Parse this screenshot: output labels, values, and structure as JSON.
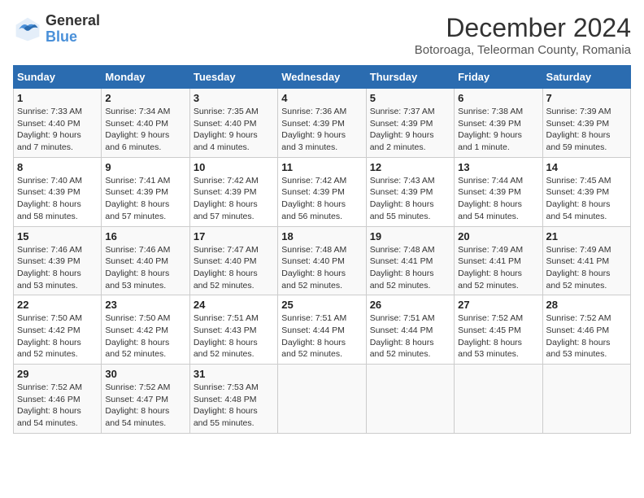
{
  "header": {
    "logo_line1": "General",
    "logo_line2": "Blue",
    "month_title": "December 2024",
    "location": "Botoroaga, Teleorman County, Romania"
  },
  "columns": [
    "Sunday",
    "Monday",
    "Tuesday",
    "Wednesday",
    "Thursday",
    "Friday",
    "Saturday"
  ],
  "weeks": [
    [
      {
        "day": "1",
        "info": "Sunrise: 7:33 AM\nSunset: 4:40 PM\nDaylight: 9 hours\nand 7 minutes."
      },
      {
        "day": "2",
        "info": "Sunrise: 7:34 AM\nSunset: 4:40 PM\nDaylight: 9 hours\nand 6 minutes."
      },
      {
        "day": "3",
        "info": "Sunrise: 7:35 AM\nSunset: 4:40 PM\nDaylight: 9 hours\nand 4 minutes."
      },
      {
        "day": "4",
        "info": "Sunrise: 7:36 AM\nSunset: 4:39 PM\nDaylight: 9 hours\nand 3 minutes."
      },
      {
        "day": "5",
        "info": "Sunrise: 7:37 AM\nSunset: 4:39 PM\nDaylight: 9 hours\nand 2 minutes."
      },
      {
        "day": "6",
        "info": "Sunrise: 7:38 AM\nSunset: 4:39 PM\nDaylight: 9 hours\nand 1 minute."
      },
      {
        "day": "7",
        "info": "Sunrise: 7:39 AM\nSunset: 4:39 PM\nDaylight: 8 hours\nand 59 minutes."
      }
    ],
    [
      {
        "day": "8",
        "info": "Sunrise: 7:40 AM\nSunset: 4:39 PM\nDaylight: 8 hours\nand 58 minutes."
      },
      {
        "day": "9",
        "info": "Sunrise: 7:41 AM\nSunset: 4:39 PM\nDaylight: 8 hours\nand 57 minutes."
      },
      {
        "day": "10",
        "info": "Sunrise: 7:42 AM\nSunset: 4:39 PM\nDaylight: 8 hours\nand 57 minutes."
      },
      {
        "day": "11",
        "info": "Sunrise: 7:42 AM\nSunset: 4:39 PM\nDaylight: 8 hours\nand 56 minutes."
      },
      {
        "day": "12",
        "info": "Sunrise: 7:43 AM\nSunset: 4:39 PM\nDaylight: 8 hours\nand 55 minutes."
      },
      {
        "day": "13",
        "info": "Sunrise: 7:44 AM\nSunset: 4:39 PM\nDaylight: 8 hours\nand 54 minutes."
      },
      {
        "day": "14",
        "info": "Sunrise: 7:45 AM\nSunset: 4:39 PM\nDaylight: 8 hours\nand 54 minutes."
      }
    ],
    [
      {
        "day": "15",
        "info": "Sunrise: 7:46 AM\nSunset: 4:39 PM\nDaylight: 8 hours\nand 53 minutes."
      },
      {
        "day": "16",
        "info": "Sunrise: 7:46 AM\nSunset: 4:40 PM\nDaylight: 8 hours\nand 53 minutes."
      },
      {
        "day": "17",
        "info": "Sunrise: 7:47 AM\nSunset: 4:40 PM\nDaylight: 8 hours\nand 52 minutes."
      },
      {
        "day": "18",
        "info": "Sunrise: 7:48 AM\nSunset: 4:40 PM\nDaylight: 8 hours\nand 52 minutes."
      },
      {
        "day": "19",
        "info": "Sunrise: 7:48 AM\nSunset: 4:41 PM\nDaylight: 8 hours\nand 52 minutes."
      },
      {
        "day": "20",
        "info": "Sunrise: 7:49 AM\nSunset: 4:41 PM\nDaylight: 8 hours\nand 52 minutes."
      },
      {
        "day": "21",
        "info": "Sunrise: 7:49 AM\nSunset: 4:41 PM\nDaylight: 8 hours\nand 52 minutes."
      }
    ],
    [
      {
        "day": "22",
        "info": "Sunrise: 7:50 AM\nSunset: 4:42 PM\nDaylight: 8 hours\nand 52 minutes."
      },
      {
        "day": "23",
        "info": "Sunrise: 7:50 AM\nSunset: 4:42 PM\nDaylight: 8 hours\nand 52 minutes."
      },
      {
        "day": "24",
        "info": "Sunrise: 7:51 AM\nSunset: 4:43 PM\nDaylight: 8 hours\nand 52 minutes."
      },
      {
        "day": "25",
        "info": "Sunrise: 7:51 AM\nSunset: 4:44 PM\nDaylight: 8 hours\nand 52 minutes."
      },
      {
        "day": "26",
        "info": "Sunrise: 7:51 AM\nSunset: 4:44 PM\nDaylight: 8 hours\nand 52 minutes."
      },
      {
        "day": "27",
        "info": "Sunrise: 7:52 AM\nSunset: 4:45 PM\nDaylight: 8 hours\nand 53 minutes."
      },
      {
        "day": "28",
        "info": "Sunrise: 7:52 AM\nSunset: 4:46 PM\nDaylight: 8 hours\nand 53 minutes."
      }
    ],
    [
      {
        "day": "29",
        "info": "Sunrise: 7:52 AM\nSunset: 4:46 PM\nDaylight: 8 hours\nand 54 minutes."
      },
      {
        "day": "30",
        "info": "Sunrise: 7:52 AM\nSunset: 4:47 PM\nDaylight: 8 hours\nand 54 minutes."
      },
      {
        "day": "31",
        "info": "Sunrise: 7:53 AM\nSunset: 4:48 PM\nDaylight: 8 hours\nand 55 minutes."
      },
      {
        "day": "",
        "info": ""
      },
      {
        "day": "",
        "info": ""
      },
      {
        "day": "",
        "info": ""
      },
      {
        "day": "",
        "info": ""
      }
    ]
  ]
}
